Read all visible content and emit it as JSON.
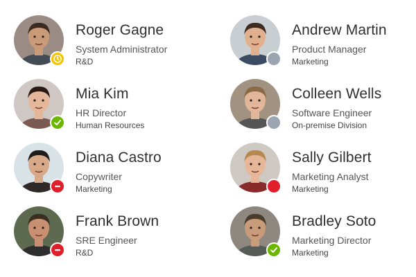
{
  "colors": {
    "away": "#f2c500",
    "available": "#6bb700",
    "busy": "#e01f2b",
    "offline": "#9aa5b1"
  },
  "contacts": [
    {
      "name": "Roger Gagne",
      "role": "System Administrator",
      "department": "R&D",
      "status": "away",
      "status_icon": "clock-icon",
      "skin": "#c99a78",
      "hair": "#3a2a1f",
      "bg": "#9a8c84",
      "shirt": "#444b55"
    },
    {
      "name": "Mia Kim",
      "role": "HR Director",
      "department": "Human Resources",
      "status": "available",
      "status_icon": "check-icon",
      "skin": "#e4b79a",
      "hair": "#2a1a14",
      "bg": "#cfc7c4",
      "shirt": "#7a5a50"
    },
    {
      "name": "Diana Castro",
      "role": "Copywriter",
      "department": "Marketing",
      "status": "busy",
      "status_icon": "minus-icon",
      "skin": "#d7a989",
      "hair": "#1f1b1a",
      "bg": "#d9e2e6",
      "shirt": "#2f2a28"
    },
    {
      "name": "Frank Brown",
      "role": "SRE Engineer",
      "department": "R&D",
      "status": "busy",
      "status_icon": "minus-icon",
      "skin": "#c98f72",
      "hair": "#3a2d22",
      "bg": "#5e6a4f",
      "shirt": "#2e2e2e"
    },
    {
      "name": "Andrew Martin",
      "role": "Product Manager",
      "department": "Marketing",
      "status": "offline",
      "status_icon": "",
      "skin": "#e0b08e",
      "hair": "#3b2b20",
      "bg": "#c9ced3",
      "shirt": "#3a4b63"
    },
    {
      "name": "Colleen Wells",
      "role": "Software Engineer",
      "department": "On-premise Division",
      "status": "offline",
      "status_icon": "",
      "skin": "#e2b69a",
      "hair": "#8b6a45",
      "bg": "#a29282",
      "shirt": "#555"
    },
    {
      "name": "Sally Gilbert",
      "role": "Marketing Analyst",
      "department": "Marketing",
      "status": "busy",
      "status_icon": "",
      "skin": "#e6b699",
      "hair": "#b8874f",
      "bg": "#cfc9c4",
      "shirt": "#8a2b2b"
    },
    {
      "name": "Bradley Soto",
      "role": "Marketing Director",
      "department": "Marketing",
      "status": "available",
      "status_icon": "check-icon",
      "skin": "#c89c7a",
      "hair": "#4a3c2c",
      "bg": "#8d8780",
      "shirt": "#575c57"
    }
  ]
}
